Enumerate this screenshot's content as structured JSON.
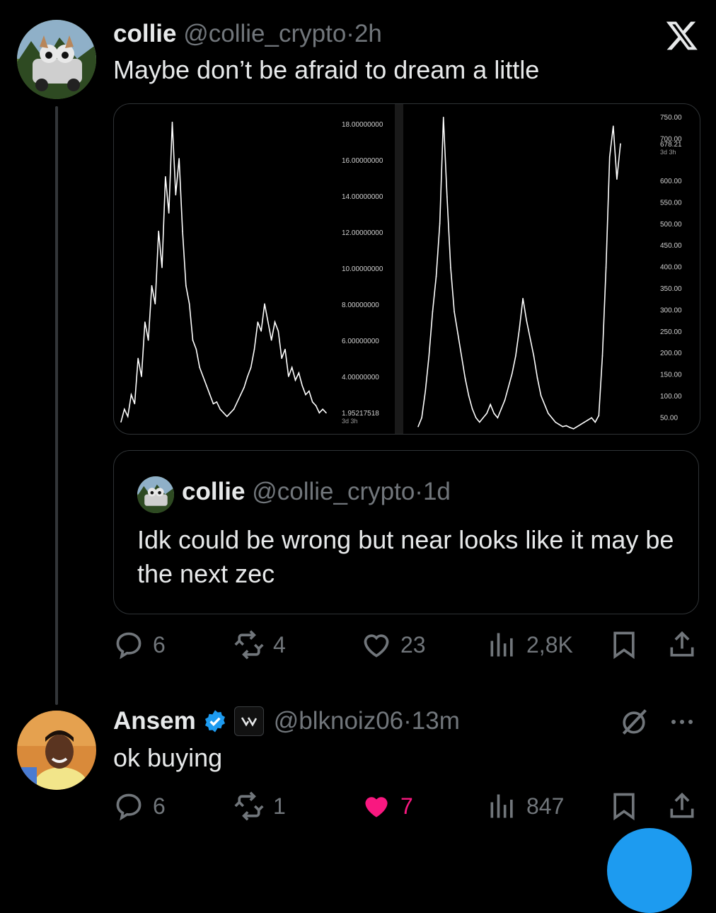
{
  "post": {
    "author_name": "collie",
    "handle": "@collie_crypto",
    "time": "2h",
    "text": "Maybe don’t be afraid to dream a little",
    "replies": "6",
    "reposts": "4",
    "likes": "23",
    "views": "2,8K"
  },
  "quote": {
    "author_name": "collie",
    "handle": "@collie_crypto",
    "time": "1d",
    "text": "Idk could be wrong but near looks like it may be the next zec"
  },
  "reply": {
    "author_name": "Ansem",
    "handle": "@blknoiz06",
    "time": "13m",
    "text": "ok buying",
    "replies": "6",
    "reposts": "1",
    "likes": "7",
    "views": "847"
  },
  "separator": "·",
  "colors": {
    "accent": "#1d9bf0",
    "like_active": "#f91880",
    "muted": "#71767b",
    "text": "#e7e9ea"
  },
  "icons": [
    "x-logo",
    "reply-icon",
    "repost-icon",
    "like-icon",
    "views-icon",
    "bookmark-icon",
    "share-icon",
    "verified-icon",
    "more-icon",
    "grok-icon"
  ],
  "chart_data": [
    {
      "type": "line",
      "y_ticks": [
        "18.00000000",
        "16.00000000",
        "14.00000000",
        "12.00000000",
        "10.00000000",
        "8.00000000",
        "6.00000000",
        "4.00000000"
      ],
      "last_price_label": "1.95217518",
      "last_price_sub": "3d 3h",
      "ylim": [
        1,
        19
      ],
      "values": [
        1.5,
        2.2,
        1.8,
        3,
        2.5,
        5,
        4,
        7,
        6,
        9,
        8,
        12,
        10,
        15,
        13,
        18,
        14,
        16,
        12,
        9,
        8,
        6,
        5.5,
        4.5,
        4,
        3.5,
        3,
        2.5,
        2.6,
        2.2,
        2,
        1.8,
        2,
        2.2,
        2.6,
        3,
        3.4,
        4,
        4.5,
        5.5,
        7,
        6.5,
        8,
        7,
        6,
        7,
        6.5,
        5,
        5.5,
        4,
        4.5,
        3.8,
        4.2,
        3.5,
        3,
        3.2,
        2.6,
        2.4,
        2,
        2.2,
        2
      ]
    },
    {
      "type": "line",
      "y_ticks": [
        "750.00",
        "700.00",
        "600.00",
        "550.00",
        "500.00",
        "450.00",
        "400.00",
        "350.00",
        "300.00",
        "250.00",
        "200.00",
        "150.00",
        "100.00",
        "50.00"
      ],
      "last_price_label": "678.21",
      "last_price_sub": "3d 3h",
      "ylim": [
        30,
        770
      ],
      "values": [
        40,
        60,
        120,
        200,
        300,
        380,
        500,
        740,
        560,
        400,
        300,
        250,
        200,
        150,
        110,
        80,
        60,
        50,
        60,
        70,
        90,
        70,
        60,
        80,
        100,
        130,
        160,
        200,
        260,
        330,
        280,
        240,
        200,
        150,
        110,
        90,
        70,
        60,
        50,
        45,
        40,
        42,
        38,
        35,
        40,
        45,
        50,
        55,
        60,
        50,
        65,
        200,
        400,
        650,
        720,
        600,
        680
      ]
    }
  ]
}
